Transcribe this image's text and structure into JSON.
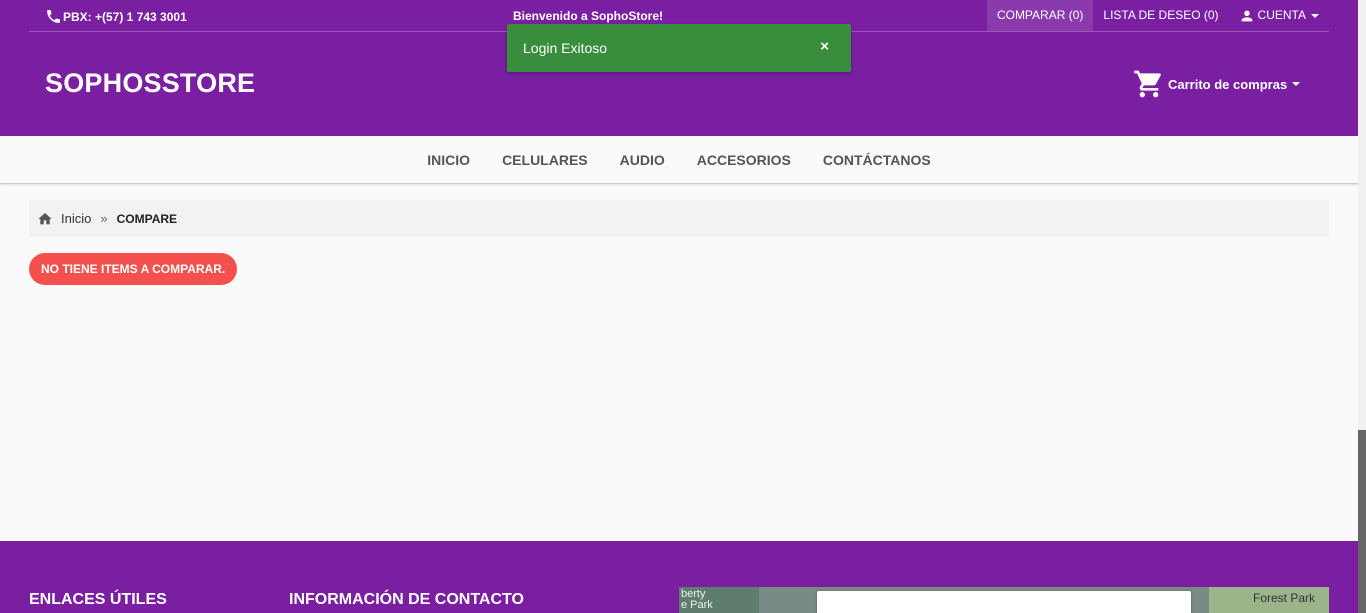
{
  "topbar": {
    "phone": "PBX: +(57) 1 743 3001",
    "welcome": "Bienvenido a SophoStore!",
    "compare": "COMPARAR (0)",
    "wishlist": "LISTA DE DESEO (0)",
    "account": "CUENTA"
  },
  "header": {
    "brand": "SOPHOSSTORE",
    "cart": "Carrito de compras"
  },
  "toast": {
    "message": "Login Exitoso",
    "close": "×"
  },
  "nav": {
    "items": [
      "INICIO",
      "CELULARES",
      "AUDIO",
      "ACCESORIOS",
      "CONTÁCTANOS"
    ]
  },
  "breadcrumb": {
    "home": "Inicio",
    "separator": "»",
    "current": "COMPARE"
  },
  "main": {
    "empty_badge": "NO TIENE ITEMS A COMPARAR."
  },
  "footer": {
    "links_title": "ENLACES ÚTILES",
    "contact_title": "INFORMACIÓN DE CONTACTO",
    "map_label_left": "berty\ne Park",
    "map_label_right": "Forest Park"
  },
  "colors": {
    "brand_purple": "#7b1fa2",
    "toast_green": "#388e3c",
    "badge_red": "#f4514e"
  }
}
